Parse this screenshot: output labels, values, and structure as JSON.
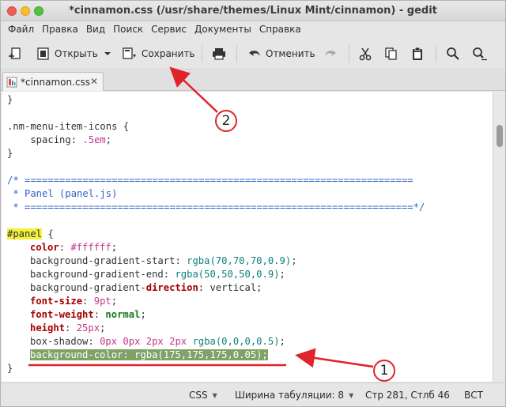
{
  "window": {
    "title": "*cinnamon.css (/usr/share/themes/Linux Mint/cinnamon) - gedit"
  },
  "menu": {
    "items": [
      "Файл",
      "Правка",
      "Вид",
      "Поиск",
      "Сервис",
      "Документы",
      "Справка"
    ]
  },
  "toolbar": {
    "open_label": "Открыть",
    "save_label": "Сохранить",
    "undo_label": "Отменить"
  },
  "tab": {
    "filename": "*cinnamon.css",
    "close_glyph": "✕"
  },
  "code": {
    "l1": "}",
    "l2": "",
    "l3_sel": ".nm-menu-item-icons {",
    "l4_prop": "    spacing",
    "l4_colon": ": ",
    "l4_val": ".5em",
    "l4_end": ";",
    "l5": "}",
    "l6": "",
    "l7": "/* ===================================================================",
    "l8": " * Panel (panel.js)",
    "l9": " * ===================================================================*/",
    "l10": "",
    "l11_sel": "#panel",
    "l11_rest": " {",
    "l12_prop": "color",
    "l12_colon": ": ",
    "l12_val": "#ffffff",
    "l12_end": ";",
    "l13_prop": "background-gradient-start",
    "l13_colon": ": ",
    "l13_fn": "rgba(70,70,70,0.9)",
    "l13_end": ";",
    "l14_prop": "background-gradient-end",
    "l14_colon": ": ",
    "l14_fn": "rgba(50,50,50,0.9)",
    "l14_end": ";",
    "l15_a": "background-gradient-",
    "l15_b": "direction",
    "l15_c": ": vertical;",
    "l16_prop": "font-size",
    "l16_colon": ": ",
    "l16_val": "9pt",
    "l16_end": ";",
    "l17_prop": "font-weight",
    "l17_colon": ": ",
    "l17_val": "normal",
    "l17_end": ";",
    "l18_prop": "height",
    "l18_colon": ": ",
    "l18_val": "25px",
    "l18_end": ";",
    "l19_a": "box-shadow: ",
    "l19_b": "0px 0px 2px 2px",
    "l19_c": " ",
    "l19_fn": "rgba(0,0,0,0.5)",
    "l19_end": ";",
    "l20_sel": "background-color: rgba(175,175,175,0.05);",
    "l21": "}"
  },
  "status": {
    "language": "CSS",
    "tab_width": "Ширина табуляции: 8",
    "position": "Стр 281, Стлб 46",
    "mode": "ВСТ"
  },
  "annotations": {
    "badge1": "1",
    "badge2": "2",
    "color": "#e0242a"
  }
}
